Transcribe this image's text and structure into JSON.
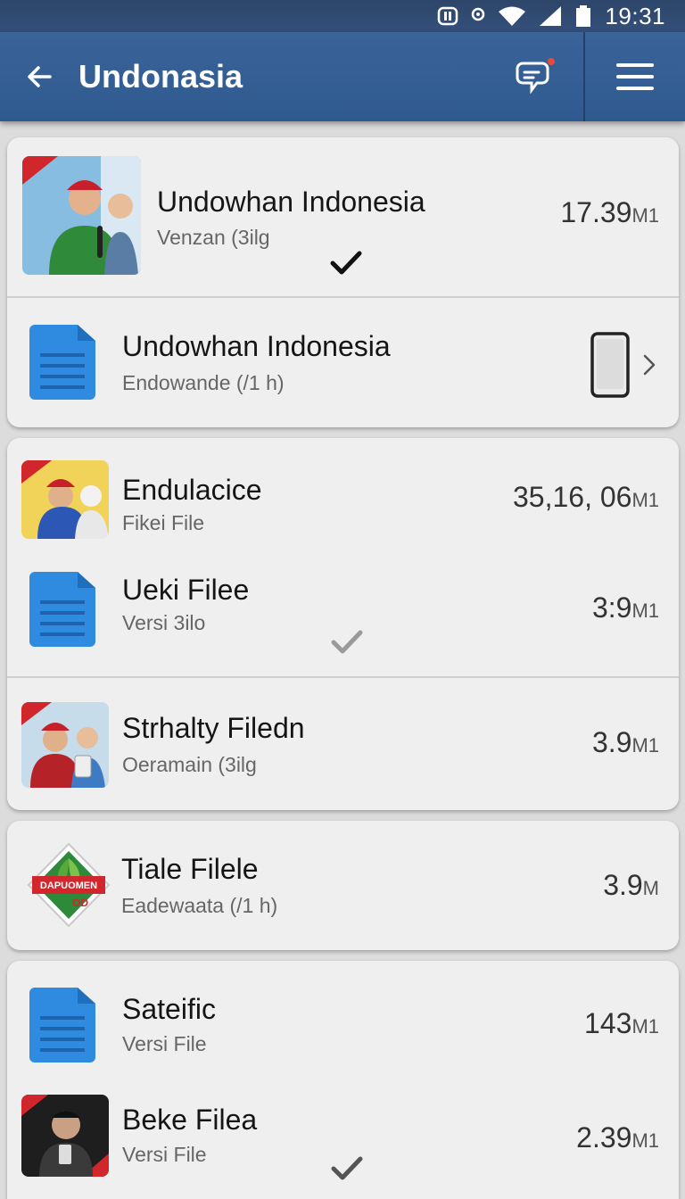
{
  "status_bar": {
    "time": "19:31",
    "icons": [
      "nfc-icon",
      "location-icon",
      "wifi-icon",
      "signal-icon",
      "battery-icon"
    ]
  },
  "app_bar": {
    "title": "Undonasia",
    "back_icon": "arrow-left-icon",
    "chat_icon": "chat-notification-icon",
    "menu_icon": "hamburger-menu-icon"
  },
  "colors": {
    "app_bar": "#2f5a8f",
    "doc_icon": "#2e8be0",
    "card": "#efefef",
    "background": "#dcdcdc"
  },
  "items": [
    {
      "title": "Undowhan Indonesia",
      "subtitle": "Venzan (3ilg",
      "size": "17.39",
      "unit": "M1",
      "icon": "photo-thumbnail",
      "checked": true
    },
    {
      "title": "Undowhan Indonesia",
      "subtitle": "Endowande (/1 h)",
      "size": "",
      "unit": "",
      "icon": "document-icon",
      "trailing": "phone-icon",
      "chevron": "chevron-right-icon"
    },
    {
      "title": "Endulacice",
      "subtitle": "Fikei File",
      "size": "35,16, 06",
      "unit": "M1",
      "icon": "photo-thumbnail"
    },
    {
      "title": "Ueki Filee",
      "subtitle": "Versi 3ilo",
      "size": "3:9",
      "unit": "M1",
      "icon": "document-icon",
      "checked": true
    },
    {
      "title": "Strhalty Filedn",
      "subtitle": "Oeramain (3ilg",
      "size": "3.9",
      "unit": "M1",
      "icon": "photo-thumbnail"
    },
    {
      "title": "Tiale Filele",
      "subtitle": "Eadewaata (/1 h)",
      "size": "3.9",
      "unit": "M",
      "icon": "logo-badge"
    },
    {
      "title": "Sateific",
      "subtitle": "Versi File",
      "size": "143",
      "unit": "M1",
      "icon": "document-icon"
    },
    {
      "title": "Beke Filea",
      "subtitle": "Versi File",
      "size": "2.39",
      "unit": "M1",
      "icon": "photo-thumbnail",
      "checked": true
    }
  ]
}
